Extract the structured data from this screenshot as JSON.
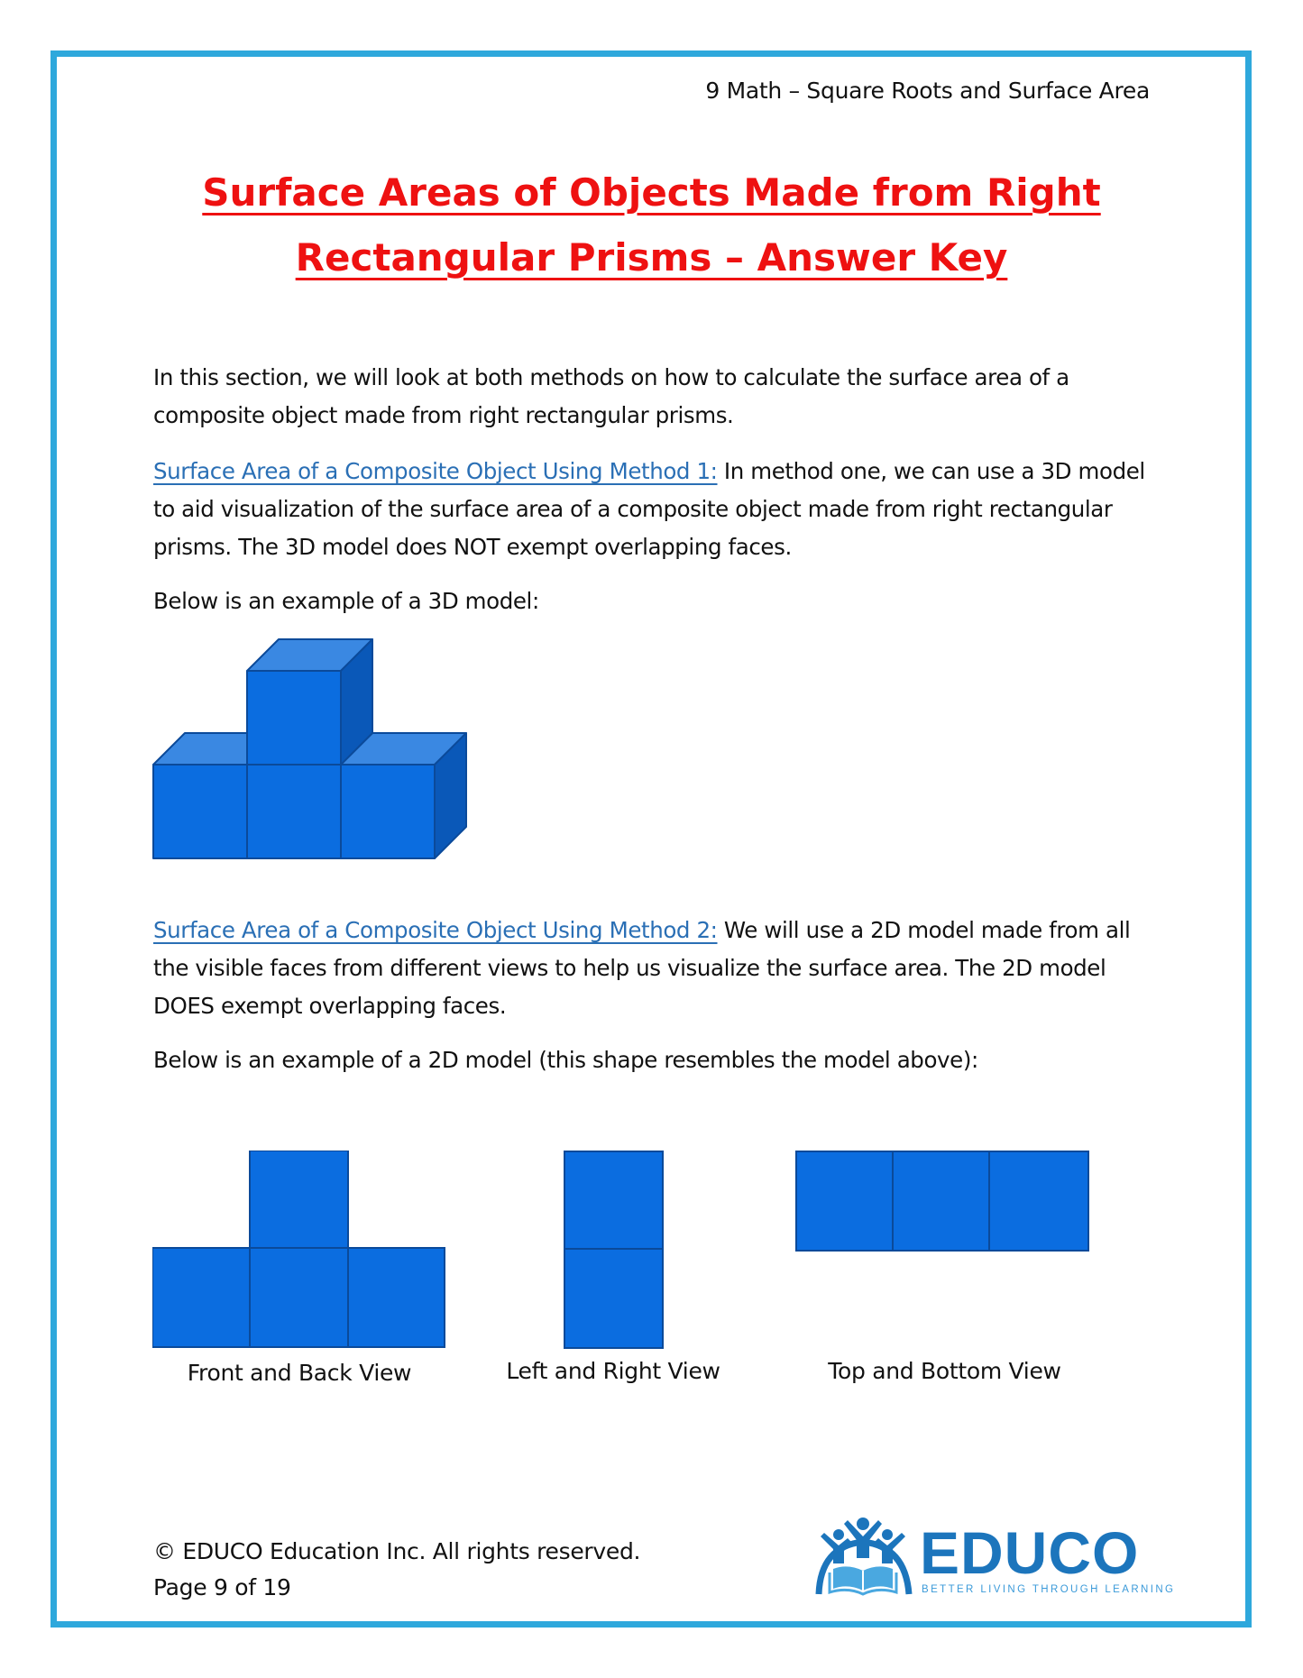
{
  "header": {
    "running_title": "9 Math – Square Roots and Surface Area"
  },
  "title": {
    "line1": "Surface Areas of Objects Made from Right",
    "line2": "Rectangular Prisms – Answer Key",
    "color": "#ee1111"
  },
  "intro": {
    "text": "In this section, we will look at both methods on how to calculate the surface area of a composite object made from right rectangular prisms."
  },
  "method1": {
    "link_text": "Surface Area of a Composite Object Using Method 1:",
    "text": " In method one, we can use a 3D model to aid visualization of the surface area of a composite object made from right rectangular prisms. The 3D model does NOT exempt overlapping faces.",
    "example_caption": "Below is an example of a 3D model:"
  },
  "method2": {
    "link_text": "Surface Area of a Composite Object Using Method 2:",
    "text": " We will use a 2D model made from all the visible faces from different views to help us visualize the surface area. The 2D model DOES exempt overlapping faces.",
    "example_caption": "Below is an example of a 2D model (this shape resembles the model above):"
  },
  "views": {
    "front_back": "Front and Back View",
    "left_right": "Left and Right View",
    "top_bottom": "Top and Bottom View"
  },
  "colors": {
    "cube_front": "#0b6de0",
    "cube_top": "#3a88e2",
    "cube_side": "#0a58b8",
    "cube_edge": "#0b4a9a",
    "frame": "#2ea8dc",
    "link": "#2a6fb5"
  },
  "footer": {
    "copyright": "© EDUCO Education Inc. All rights reserved.",
    "page": "Page 9 of 19"
  },
  "logo": {
    "word": "EDUCO",
    "tagline": "BETTER LIVING THROUGH LEARNING"
  }
}
